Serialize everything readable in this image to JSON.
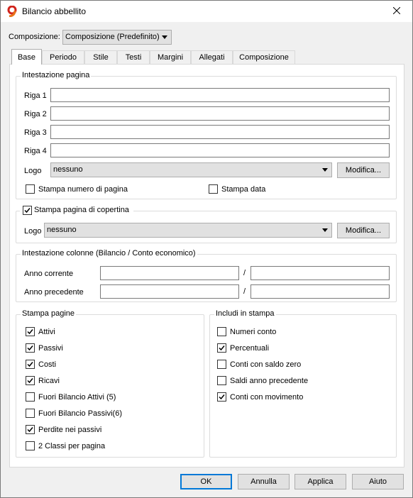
{
  "window": {
    "title": "Bilancio abbellito"
  },
  "composizione": {
    "label": "Composizione:",
    "value": "Composizione (Predefinito)"
  },
  "tabs": [
    "Base",
    "Periodo",
    "Stile",
    "Testi",
    "Margini",
    "Allegati",
    "Composizione"
  ],
  "intestazione": {
    "title": "Intestazione pagina",
    "rows": [
      {
        "label": "Riga 1",
        "value": ""
      },
      {
        "label": "Riga 2",
        "value": ""
      },
      {
        "label": "Riga 3",
        "value": ""
      },
      {
        "label": "Riga 4",
        "value": ""
      }
    ],
    "logo_label": "Logo",
    "logo_value": "nessuno",
    "modifica": "Modifica...",
    "stampa_numero": "Stampa numero di pagina",
    "stampa_data": "Stampa data"
  },
  "copertina": {
    "title": "Stampa pagina di copertina",
    "checked": true,
    "logo_label": "Logo",
    "logo_value": "nessuno",
    "modifica": "Modifica..."
  },
  "colonne": {
    "title": "Intestazione colonne (Bilancio / Conto economico)",
    "anno_corrente": "Anno corrente",
    "anno_precedente": "Anno precedente",
    "sep": "/"
  },
  "stampa_pagine": {
    "title": "Stampa pagine",
    "items": [
      {
        "label": "Attivi",
        "checked": true
      },
      {
        "label": "Passivi",
        "checked": true
      },
      {
        "label": "Costi",
        "checked": true
      },
      {
        "label": "Ricavi",
        "checked": true
      },
      {
        "label": "Fuori Bilancio Attivi (5)",
        "checked": false
      },
      {
        "label": "Fuori Bilancio Passivi(6)",
        "checked": false
      },
      {
        "label": "Perdite nei passivi",
        "checked": true
      },
      {
        "label": "2 Classi per pagina",
        "checked": false
      }
    ]
  },
  "includi": {
    "title": "Includi in stampa",
    "items": [
      {
        "label": "Numeri conto",
        "checked": false
      },
      {
        "label": "Percentuali",
        "checked": true
      },
      {
        "label": "Conti con saldo zero",
        "checked": false
      },
      {
        "label": "Saldi anno precedente",
        "checked": false
      },
      {
        "label": "Conti con movimento",
        "checked": true
      }
    ]
  },
  "buttons": {
    "ok": "OK",
    "annulla": "Annulla",
    "applica": "Applica",
    "aiuto": "Aiuto"
  },
  "colors": {
    "accent": "#0078d7",
    "logo_orange": "#e8731a",
    "logo_red": "#d0241c"
  }
}
